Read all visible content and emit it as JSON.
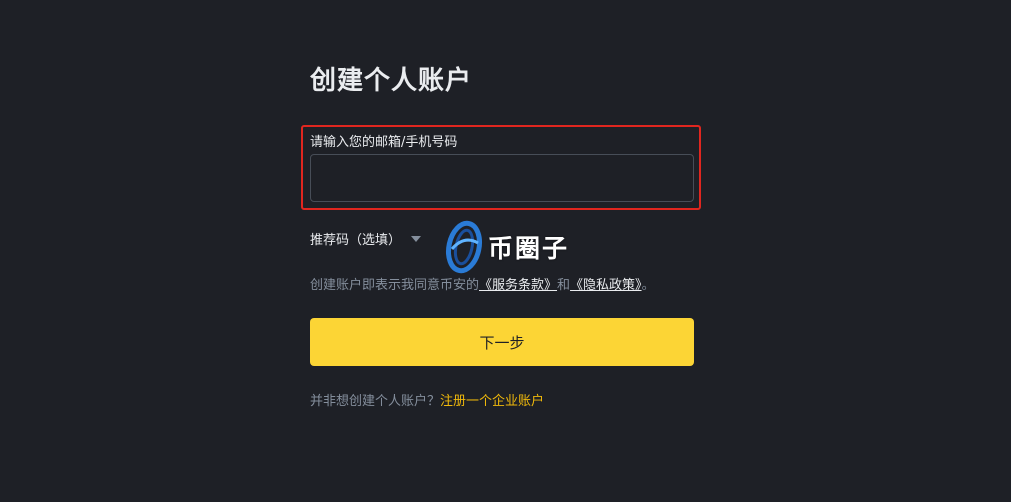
{
  "form": {
    "title": "创建个人账户",
    "identifier_label": "请输入您的邮箱/手机号码",
    "identifier_value": "",
    "referral_label": "推荐码（选填）",
    "terms": {
      "prefix": "创建账户即表示我同意币安的",
      "service_link": "《服务条款》",
      "middle": "和",
      "privacy_link": "《隐私政策》",
      "suffix": "。"
    },
    "next_button": "下一步",
    "footer": {
      "prefix": "并非想创建个人账户？",
      "business_link": "注册一个企业账户"
    }
  },
  "watermark": {
    "text": "币圈子",
    "icon": "bqz-logo-icon"
  },
  "colors": {
    "background": "#1e2026",
    "primary_button": "#fcd535",
    "link_accent": "#f0b90b",
    "highlight_border": "#e0261f",
    "muted_text": "#848e9c"
  }
}
